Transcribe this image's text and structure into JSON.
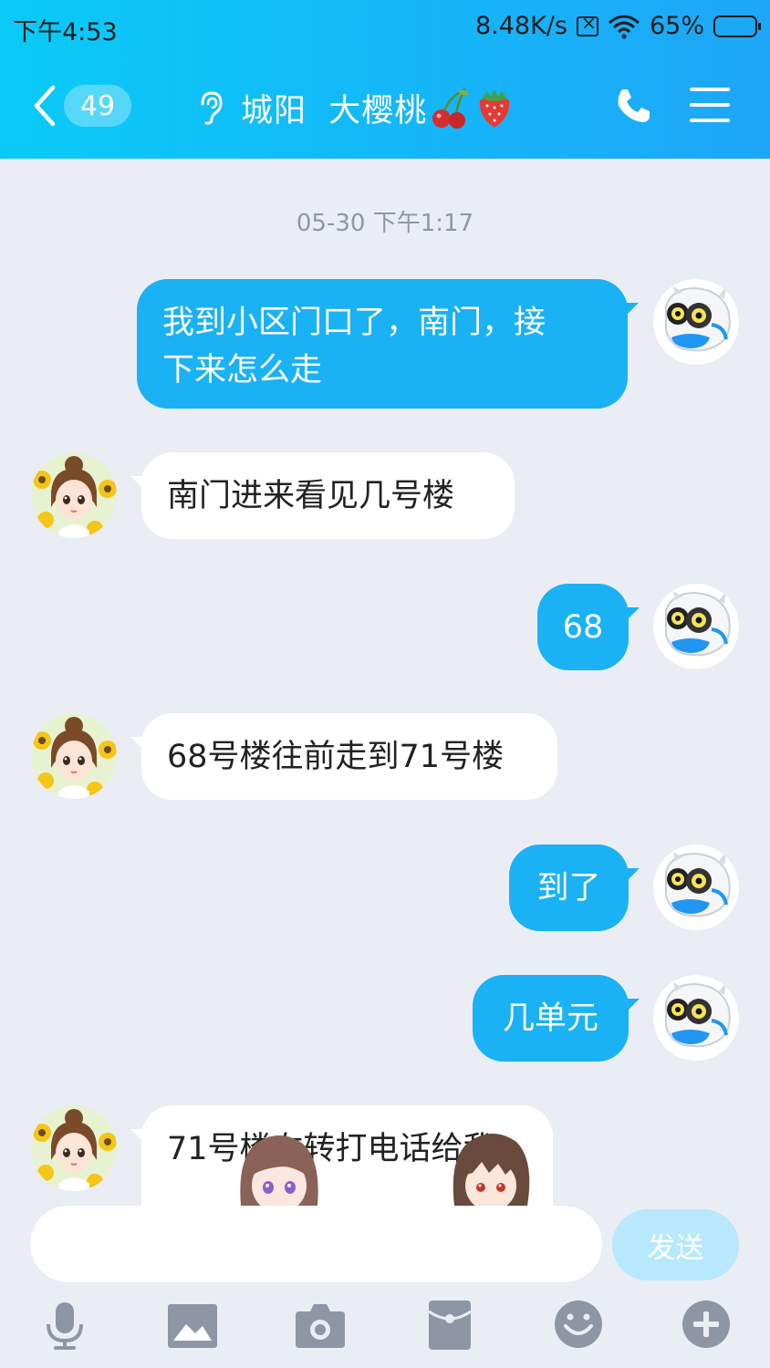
{
  "status_bar": {
    "time": "下午4:53",
    "network_speed": "8.48K/s",
    "battery": "65%"
  },
  "header": {
    "unread_count": "49",
    "title": "城阳  大樱桃",
    "icons": [
      "back-chevron-icon",
      "ear-icon",
      "cherry-icon",
      "strawberry-icon",
      "phone-icon",
      "menu-icon"
    ]
  },
  "chat": {
    "timestamp": "05-30 下午1:17",
    "messages": [
      {
        "from": "me",
        "line1": "我到小区门口了，南门，接",
        "line2": "下来怎么走"
      },
      {
        "from": "other",
        "text": "南门进来看见几号楼"
      },
      {
        "from": "me",
        "text": "68"
      },
      {
        "from": "other",
        "text": "68号楼往前走到71号楼"
      },
      {
        "from": "me",
        "text": "到了"
      },
      {
        "from": "me",
        "text": "几单元"
      },
      {
        "from": "other",
        "text": "71号楼右转打电话给我"
      }
    ]
  },
  "input": {
    "value": "",
    "send_label": "发送"
  },
  "toolbar": [
    "microphone-icon",
    "image-icon",
    "camera-icon",
    "red-packet-icon",
    "emoji-icon",
    "plus-icon"
  ],
  "colors": {
    "header_start": "#0ACBF7",
    "header_end": "#1EA6F7",
    "bubble_out": "#1AB2F5",
    "bubble_in": "#FFFFFF",
    "background": "#EBEDF5",
    "send_disabled": "#B8E8FB"
  }
}
